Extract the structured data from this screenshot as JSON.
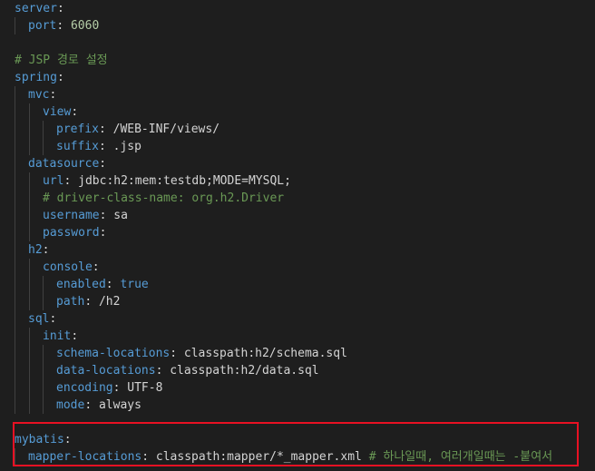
{
  "lines": [
    {
      "key": "server",
      "sep": ":",
      "value": "",
      "value_type": "",
      "comment": ""
    },
    {
      "key": "port",
      "sep": ": ",
      "value": "6060",
      "value_type": "n",
      "comment": ""
    },
    {
      "key": "",
      "sep": "",
      "value": "",
      "value_type": "",
      "comment": ""
    },
    {
      "key": "",
      "sep": "",
      "value": "",
      "value_type": "",
      "comment": "# JSP 경로 설정"
    },
    {
      "key": "spring",
      "sep": ":",
      "value": "",
      "value_type": "",
      "comment": ""
    },
    {
      "key": "mvc",
      "sep": ":",
      "value": "",
      "value_type": "",
      "comment": ""
    },
    {
      "key": "view",
      "sep": ":",
      "value": "",
      "value_type": "",
      "comment": ""
    },
    {
      "key": "prefix",
      "sep": ": ",
      "value": "/WEB-INF/views/",
      "value_type": "s",
      "comment": ""
    },
    {
      "key": "suffix",
      "sep": ": ",
      "value": ".jsp",
      "value_type": "s",
      "comment": ""
    },
    {
      "key": "datasource",
      "sep": ":",
      "value": "",
      "value_type": "",
      "comment": ""
    },
    {
      "key": "url",
      "sep": ": ",
      "value": "jdbc:h2:mem:testdb;MODE=MYSQL;",
      "value_type": "s",
      "comment": ""
    },
    {
      "key": "",
      "sep": "",
      "value": "",
      "value_type": "",
      "comment": "# driver-class-name: org.h2.Driver"
    },
    {
      "key": "username",
      "sep": ": ",
      "value": "sa",
      "value_type": "s",
      "comment": ""
    },
    {
      "key": "password",
      "sep": ":",
      "value": "",
      "value_type": "",
      "comment": ""
    },
    {
      "key": "h2",
      "sep": ":",
      "value": "",
      "value_type": "",
      "comment": ""
    },
    {
      "key": "console",
      "sep": ":",
      "value": "",
      "value_type": "",
      "comment": ""
    },
    {
      "key": "enabled",
      "sep": ": ",
      "value": "true",
      "value_type": "k",
      "comment": ""
    },
    {
      "key": "path",
      "sep": ": ",
      "value": "/h2",
      "value_type": "s",
      "comment": ""
    },
    {
      "key": "sql",
      "sep": ":",
      "value": "",
      "value_type": "",
      "comment": ""
    },
    {
      "key": "init",
      "sep": ":",
      "value": "",
      "value_type": "",
      "comment": ""
    },
    {
      "key": "schema-locations",
      "sep": ": ",
      "value": "classpath:h2/schema.sql",
      "value_type": "s",
      "comment": ""
    },
    {
      "key": "data-locations",
      "sep": ": ",
      "value": "classpath:h2/data.sql",
      "value_type": "s",
      "comment": ""
    },
    {
      "key": "encoding",
      "sep": ": ",
      "value": "UTF-8",
      "value_type": "s",
      "comment": ""
    },
    {
      "key": "mode",
      "sep": ": ",
      "value": "always",
      "value_type": "s",
      "comment": ""
    },
    {
      "key": "",
      "sep": "",
      "value": "",
      "value_type": "",
      "comment": ""
    },
    {
      "key": "mybatis",
      "sep": ":",
      "value": "",
      "value_type": "",
      "comment": ""
    },
    {
      "key": "mapper-locations",
      "sep": ": ",
      "value": "classpath:mapper/*_mapper.xml ",
      "value_type": "s",
      "comment": "# 하나일때, 여러개일때는 -붙여서"
    }
  ],
  "colors": {
    "background": "#1e1e1e",
    "key": "#569cd6",
    "string": "#d4d4d4",
    "number": "#b5cea8",
    "comment": "#6a9955",
    "highlight_border": "#e81123"
  }
}
